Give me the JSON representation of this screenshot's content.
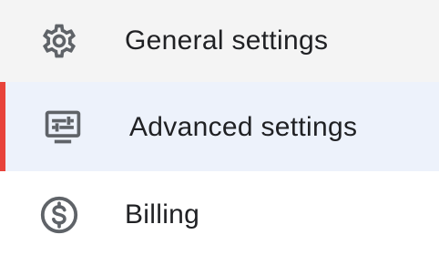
{
  "menu": {
    "items": [
      {
        "label": "General settings",
        "icon": "gear-icon",
        "active": false
      },
      {
        "label": "Advanced settings",
        "icon": "advanced-settings-icon",
        "active": true
      },
      {
        "label": "Billing",
        "icon": "dollar-circle-icon",
        "active": false
      }
    ]
  },
  "colors": {
    "active_indicator": "#e8433a",
    "active_background": "#edf2fb",
    "general_background": "#f4f4f4",
    "icon": "#5f6368",
    "text": "#202124"
  }
}
